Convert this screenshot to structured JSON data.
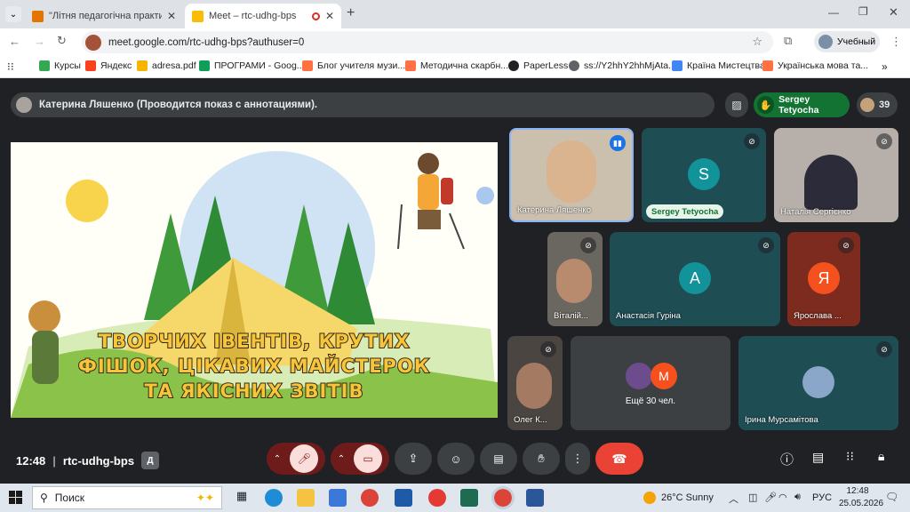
{
  "browser": {
    "tabs": [
      {
        "label": "\"Літня педагогічна практика 2",
        "active": false
      },
      {
        "label": "Meet – rtc-udhg-bps",
        "active": true
      }
    ],
    "url": "meet.google.com/rtc-udhg-bps?authuser=0",
    "profile_label": "Учебный",
    "bookmarks": [
      "Курсы",
      "Яндекс",
      "adresa.pdf",
      "ПРОГРАМИ - Goog...",
      "Блог учителя музи...",
      "Методична скарбн...",
      "PaperLess",
      "ss://Y2hhY2hhMjAta...",
      "Країна Мистецтва",
      "Українська мова та..."
    ]
  },
  "meet": {
    "presenter_bar": "Катерина Ляшенко (Проводится показ с аннотациями).",
    "host_chip": "Sergey Tetyocha",
    "participants_count": "39",
    "slide_text": [
      "ТВОРЧИХ ІВЕНТІВ, КРУТИХ",
      "ФІШОК, ЦІКАВИХ МАЙСТЕРОК",
      "ТА ЯКІСНИХ ЗВІТІВ"
    ],
    "tiles": [
      {
        "name": "Катерина Ляшенко"
      },
      {
        "name": "Sergey Tetyocha",
        "avatar": "S"
      },
      {
        "name": "Наталія Сергієнко"
      },
      {
        "name": "Віталій..."
      },
      {
        "name": "Анастасія Гуріна",
        "avatar": "А"
      },
      {
        "name": "Ярослава ...",
        "avatar": "Я"
      },
      {
        "name": "Олег К..."
      },
      {
        "name": "Ещё 30 чел.",
        "avatar": "M"
      },
      {
        "name": "Ірина Мурсамітова"
      }
    ],
    "clock": "12:48",
    "meeting_code": "rtc-udhg-bps"
  },
  "taskbar": {
    "search_placeholder": "Поиск",
    "weather": "26°C  Sunny",
    "lang": "РУС",
    "time": "12:48",
    "date": "25.05.2026"
  },
  "colors": {
    "meet_bg": "#202124",
    "tile_teal": "#1e4d54",
    "end_red": "#ea4335",
    "host_green": "#137333"
  }
}
